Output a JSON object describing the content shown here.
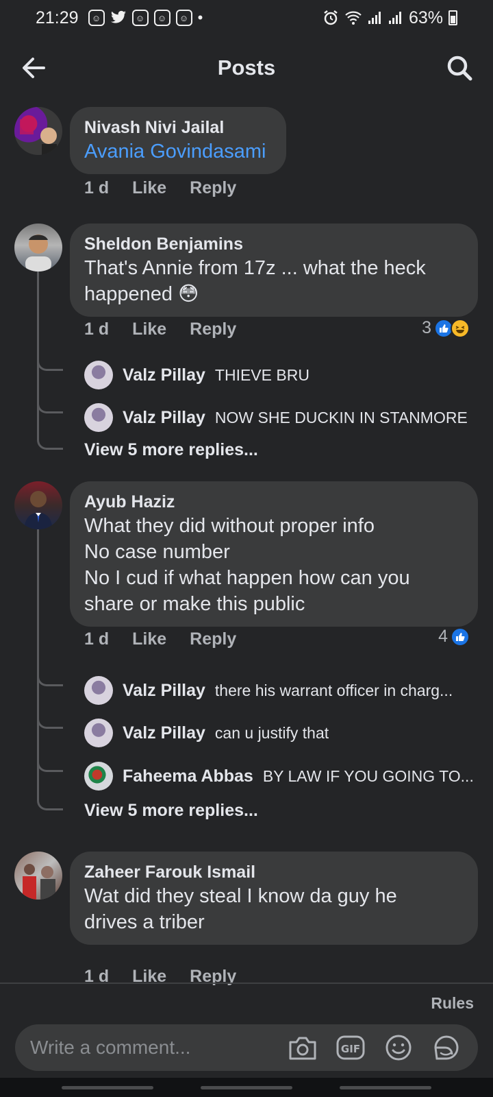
{
  "status_bar": {
    "time": "21:29",
    "battery": "63%"
  },
  "header": {
    "title": "Posts"
  },
  "comments": [
    {
      "author": "Nivash Nivi Jailal",
      "mention": "Avania Govindasami",
      "time": "1 d",
      "like": "Like",
      "reply": "Reply"
    },
    {
      "author": "Sheldon Benjamins",
      "text_line1": "That's Annie from 17z ... what the heck",
      "text_line2": "happened",
      "emoji": "😳",
      "time": "1 d",
      "like": "Like",
      "reply": "Reply",
      "reaction_count": "3",
      "replies": [
        {
          "author": "Valz Pillay",
          "text": "THIEVE BRU"
        },
        {
          "author": "Valz Pillay",
          "text": "NOW SHE DUCKIN IN STANMORE"
        }
      ],
      "view_more": "View 5 more replies..."
    },
    {
      "author": "Ayub Haziz",
      "lines": [
        "What they did without proper info",
        "No case number",
        "No I cud if what happen how can you",
        "share or make this public"
      ],
      "time": "1 d",
      "like": "Like",
      "reply": "Reply",
      "reaction_count": "4",
      "replies": [
        {
          "author": "Valz Pillay",
          "text": "there his warrant officer in charg..."
        },
        {
          "author": "Valz Pillay",
          "text": "can u justify that"
        },
        {
          "author": "Faheema Abbas",
          "text": "BY LAW IF YOU GOING TO..."
        }
      ],
      "view_more": "View 5 more replies..."
    },
    {
      "author": "Zaheer Farouk Ismail",
      "text_line1": "Wat did they steal I know da guy he",
      "text_line2": "drives a triber",
      "time": "1 d",
      "like": "Like",
      "reply": "Reply"
    }
  ],
  "footer": {
    "rules": "Rules",
    "composer_placeholder": "Write a comment..."
  },
  "icons": {
    "back": "arrow-left-icon",
    "search": "search-icon",
    "camera": "camera-icon",
    "gif": "gif-icon",
    "emoji": "smiley-icon",
    "sticker": "sticker-icon"
  },
  "colors": {
    "background": "#242527",
    "bubble": "#3a3b3c",
    "mention": "#4b9eff",
    "like_blue": "#1b74e4"
  }
}
